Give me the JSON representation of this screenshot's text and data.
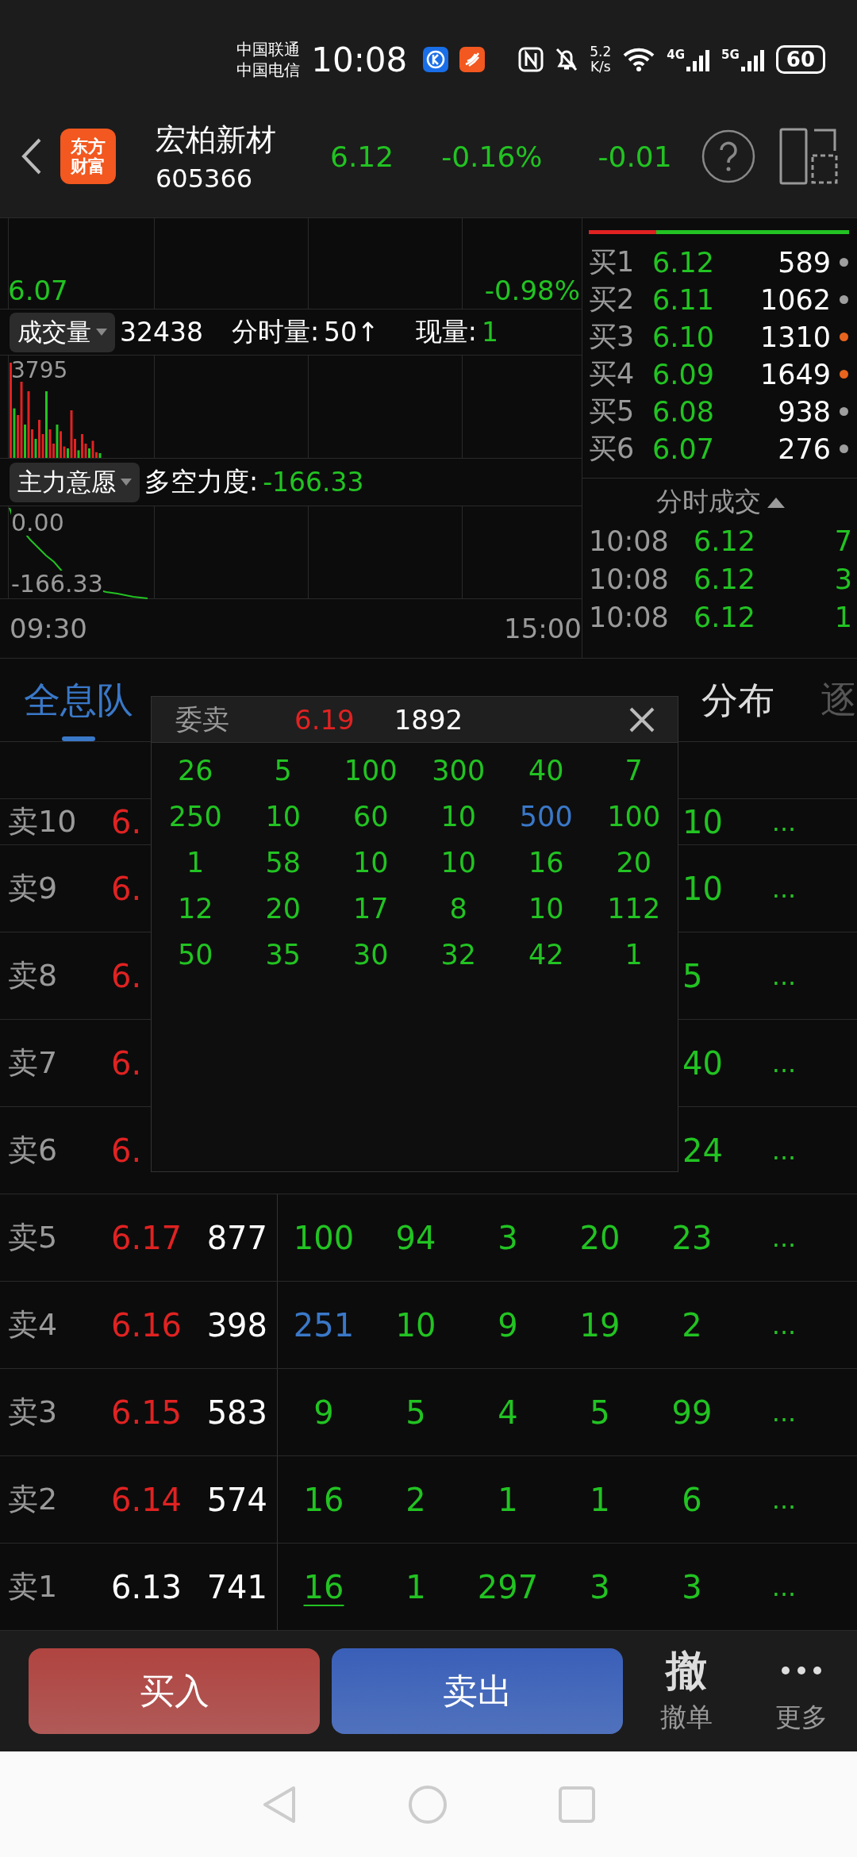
{
  "status_bar": {
    "carriers": [
      "中国联通",
      "中国电信"
    ],
    "time": "10:08",
    "speed": "5.2",
    "speed_unit": "K/s",
    "network_1": "4G",
    "network_2": "5G",
    "battery": "60"
  },
  "header": {
    "logo": [
      "东方",
      "财富"
    ],
    "name": "宏柏新材",
    "code": "605366",
    "price": "6.12",
    "change_pct": "-0.16%",
    "change": "-0.01"
  },
  "intraday": {
    "price": "6.07",
    "pct": "-0.98%",
    "time_start": "09:30",
    "time_end": "15:00",
    "volume_panel": {
      "selector": "成交量",
      "total": "32438",
      "minute_label": "分时量:",
      "minute_value": "50↑",
      "current_label": "现量:",
      "current_value": "1",
      "peak": "3795"
    },
    "force_panel": {
      "selector": "主力意愿",
      "label": "多空力度:",
      "value": "-166.33",
      "top_tick": "0.00",
      "bottom_tick": "-166.33"
    }
  },
  "order_book": {
    "level": 0.26,
    "bids": [
      {
        "label": "买1",
        "price": "6.12",
        "volume": "589",
        "color": "#9e9e9e"
      },
      {
        "label": "买2",
        "price": "6.11",
        "volume": "1062",
        "color": "#9e9e9e"
      },
      {
        "label": "买3",
        "price": "6.10",
        "volume": "1310",
        "color": "#e8641e"
      },
      {
        "label": "买4",
        "price": "6.09",
        "volume": "1649",
        "color": "#e8641e"
      },
      {
        "label": "买5",
        "price": "6.08",
        "volume": "938",
        "color": "#9e9e9e"
      },
      {
        "label": "买6",
        "price": "6.07",
        "volume": "276",
        "color": "#9e9e9e"
      }
    ],
    "trades_title": "分时成交",
    "trades": [
      {
        "time": "10:08",
        "price": "6.12",
        "volume": "7"
      },
      {
        "time": "10:08",
        "price": "6.12",
        "volume": "3"
      },
      {
        "time": "10:08",
        "price": "6.12",
        "volume": "1"
      }
    ]
  },
  "tabs": [
    {
      "label": "全息队",
      "selected": true
    },
    {
      "label": "分布",
      "selected": false
    },
    {
      "label": "逐",
      "selected": false
    }
  ],
  "queue": [
    {
      "label": "卖10",
      "covered": true,
      "price": "6.",
      "rising": true,
      "last_order": "10",
      "more": "..."
    },
    {
      "label": "卖9",
      "covered": true,
      "price": "6.",
      "rising": true,
      "last_order": "10",
      "more": "..."
    },
    {
      "label": "卖8",
      "covered": true,
      "price": "6.",
      "rising": true,
      "last_order": "5",
      "more": "..."
    },
    {
      "label": "卖7",
      "covered": true,
      "price": "6.",
      "rising": true,
      "last_order": "40",
      "more": "..."
    },
    {
      "label": "卖6",
      "covered": true,
      "price": "6.",
      "rising": true,
      "last_order": "24",
      "more": "..."
    },
    {
      "label": "卖5",
      "covered": false,
      "price": "6.17",
      "rising": true,
      "volume": "877",
      "more": "...",
      "orders": [
        {
          "text": "100",
          "kind": "normal"
        },
        {
          "text": "94",
          "kind": "normal"
        },
        {
          "text": "3",
          "kind": "normal"
        },
        {
          "text": "20",
          "kind": "normal"
        },
        {
          "text": "23",
          "kind": "normal"
        }
      ]
    },
    {
      "label": "卖4",
      "covered": false,
      "price": "6.16",
      "rising": true,
      "volume": "398",
      "more": "...",
      "orders": [
        {
          "text": "251",
          "kind": "large"
        },
        {
          "text": "10",
          "kind": "normal"
        },
        {
          "text": "9",
          "kind": "normal"
        },
        {
          "text": "19",
          "kind": "normal"
        },
        {
          "text": "2",
          "kind": "normal"
        }
      ]
    },
    {
      "label": "卖3",
      "covered": false,
      "price": "6.15",
      "rising": true,
      "volume": "583",
      "more": "...",
      "orders": [
        {
          "text": "9",
          "kind": "normal"
        },
        {
          "text": "5",
          "kind": "normal"
        },
        {
          "text": "4",
          "kind": "normal"
        },
        {
          "text": "5",
          "kind": "normal"
        },
        {
          "text": "99",
          "kind": "normal"
        }
      ]
    },
    {
      "label": "卖2",
      "covered": false,
      "price": "6.14",
      "rising": true,
      "volume": "574",
      "more": "...",
      "orders": [
        {
          "text": "16",
          "kind": "normal"
        },
        {
          "text": "2",
          "kind": "normal"
        },
        {
          "text": "1",
          "kind": "normal"
        },
        {
          "text": "1",
          "kind": "normal"
        },
        {
          "text": "6",
          "kind": "normal"
        }
      ]
    },
    {
      "label": "卖1",
      "covered": false,
      "price": "6.13",
      "rising": false,
      "volume": "741",
      "more": "...",
      "orders": [
        {
          "text": "16",
          "kind": "current"
        },
        {
          "text": "1",
          "kind": "normal"
        },
        {
          "text": "297",
          "kind": "normal"
        },
        {
          "text": "3",
          "kind": "normal"
        },
        {
          "text": "3",
          "kind": "normal"
        }
      ]
    }
  ],
  "popup": {
    "title": "委卖",
    "price": "6.19",
    "volume": "1892",
    "orders": [
      [
        {
          "text": "26",
          "kind": "normal"
        },
        {
          "text": "5",
          "kind": "normal"
        },
        {
          "text": "100",
          "kind": "normal"
        },
        {
          "text": "300",
          "kind": "normal"
        },
        {
          "text": "40",
          "kind": "normal"
        },
        {
          "text": "7",
          "kind": "normal"
        }
      ],
      [
        {
          "text": "250",
          "kind": "normal"
        },
        {
          "text": "10",
          "kind": "normal"
        },
        {
          "text": "60",
          "kind": "normal"
        },
        {
          "text": "10",
          "kind": "normal"
        },
        {
          "text": "500",
          "kind": "large"
        },
        {
          "text": "100",
          "kind": "normal"
        }
      ],
      [
        {
          "text": "1",
          "kind": "normal"
        },
        {
          "text": "58",
          "kind": "normal"
        },
        {
          "text": "10",
          "kind": "normal"
        },
        {
          "text": "10",
          "kind": "normal"
        },
        {
          "text": "16",
          "kind": "normal"
        },
        {
          "text": "20",
          "kind": "normal"
        }
      ],
      [
        {
          "text": "12",
          "kind": "normal"
        },
        {
          "text": "20",
          "kind": "normal"
        },
        {
          "text": "17",
          "kind": "normal"
        },
        {
          "text": "8",
          "kind": "normal"
        },
        {
          "text": "10",
          "kind": "normal"
        },
        {
          "text": "112",
          "kind": "normal"
        }
      ],
      [
        {
          "text": "50",
          "kind": "normal"
        },
        {
          "text": "35",
          "kind": "normal"
        },
        {
          "text": "30",
          "kind": "normal"
        },
        {
          "text": "32",
          "kind": "normal"
        },
        {
          "text": "42",
          "kind": "normal"
        },
        {
          "text": "1",
          "kind": "normal"
        }
      ]
    ]
  },
  "actions": {
    "buy": "买入",
    "sell": "卖出",
    "cancel_glyph": "撤",
    "cancel": "撤单",
    "more": "更多"
  }
}
